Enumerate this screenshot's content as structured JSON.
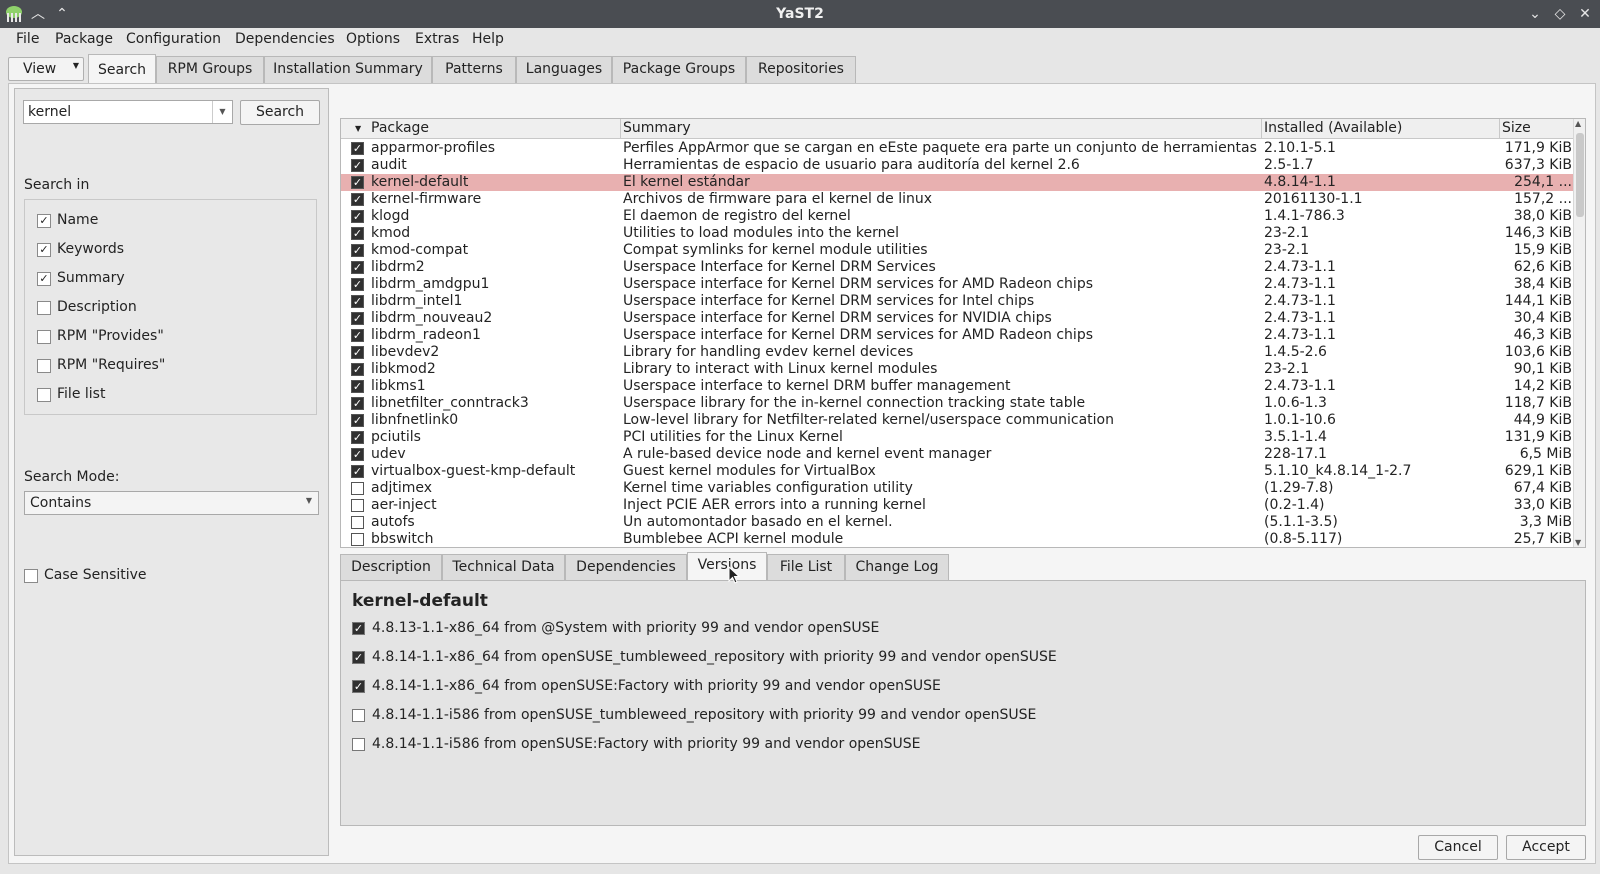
{
  "window": {
    "title": "YaST2"
  },
  "menu": [
    "File",
    "Package",
    "Configuration",
    "Dependencies",
    "Options",
    "Extras",
    "Help"
  ],
  "top_tabs": {
    "view": "View",
    "tabs": [
      "Search",
      "RPM Groups",
      "Installation Summary",
      "Patterns",
      "Languages",
      "Package Groups",
      "Repositories"
    ],
    "active": "Search"
  },
  "search": {
    "query": "kernel",
    "button": "Search",
    "search_in_label": "Search in",
    "options": [
      {
        "label": "Name",
        "checked": true
      },
      {
        "label": "Keywords",
        "checked": true
      },
      {
        "label": "Summary",
        "checked": true
      },
      {
        "label": "Description",
        "checked": false
      },
      {
        "label": "RPM \"Provides\"",
        "checked": false
      },
      {
        "label": "RPM \"Requires\"",
        "checked": false
      },
      {
        "label": "File list",
        "checked": false
      }
    ],
    "mode_label": "Search Mode:",
    "mode_value": "Contains",
    "case_sensitive": "Case Sensitive"
  },
  "table": {
    "headers": [
      "Package",
      "Summary",
      "Installed (Available)",
      "Size"
    ],
    "rows": [
      {
        "installed": true,
        "name": "apparmor-profiles",
        "summary": "Perfiles AppArmor que se cargan en eEste paquete era parte un conjunto de herramientas ...",
        "version": "2.10.1-5.1",
        "size": "171,9 KiB"
      },
      {
        "installed": true,
        "name": "audit",
        "summary": "Herramientas de espacio de usuario para auditoría del kernel 2.6",
        "version": "2.5-1.7",
        "size": "637,3 KiB"
      },
      {
        "installed": true,
        "name": "kernel-default",
        "summary": "El kernel estándar",
        "version": "4.8.14-1.1",
        "size": "254,1 ...",
        "selected": true
      },
      {
        "installed": true,
        "name": "kernel-firmware",
        "summary": "Archivos de firmware para el kernel de linux",
        "version": "20161130-1.1",
        "size": "157,2 ..."
      },
      {
        "installed": true,
        "name": "klogd",
        "summary": "El daemon de registro del kernel",
        "version": "1.4.1-786.3",
        "size": "38,0 KiB"
      },
      {
        "installed": true,
        "name": "kmod",
        "summary": "Utilities to load modules into the kernel",
        "version": "23-2.1",
        "size": "146,3 KiB"
      },
      {
        "installed": true,
        "name": "kmod-compat",
        "summary": "Compat symlinks for kernel module utilities",
        "version": "23-2.1",
        "size": "15,9 KiB"
      },
      {
        "installed": true,
        "name": "libdrm2",
        "summary": "Userspace Interface for Kernel DRM Services",
        "version": "2.4.73-1.1",
        "size": "62,6 KiB"
      },
      {
        "installed": true,
        "name": "libdrm_amdgpu1",
        "summary": "Userspace interface for Kernel DRM services for AMD Radeon chips",
        "version": "2.4.73-1.1",
        "size": "38,4 KiB"
      },
      {
        "installed": true,
        "name": "libdrm_intel1",
        "summary": "Userspace interface for Kernel DRM services for Intel chips",
        "version": "2.4.73-1.1",
        "size": "144,1 KiB"
      },
      {
        "installed": true,
        "name": "libdrm_nouveau2",
        "summary": "Userspace interface for Kernel DRM services for NVIDIA chips",
        "version": "2.4.73-1.1",
        "size": "30,4 KiB"
      },
      {
        "installed": true,
        "name": "libdrm_radeon1",
        "summary": "Userspace interface for Kernel DRM services for AMD Radeon chips",
        "version": "2.4.73-1.1",
        "size": "46,3 KiB"
      },
      {
        "installed": true,
        "name": "libevdev2",
        "summary": "Library for handling evdev kernel devices",
        "version": "1.4.5-2.6",
        "size": "103,6 KiB"
      },
      {
        "installed": true,
        "name": "libkmod2",
        "summary": "Library to interact with Linux kernel modules",
        "version": "23-2.1",
        "size": "90,1 KiB"
      },
      {
        "installed": true,
        "name": "libkms1",
        "summary": "Userspace interface to kernel DRM buffer management",
        "version": "2.4.73-1.1",
        "size": "14,2 KiB"
      },
      {
        "installed": true,
        "name": "libnetfilter_conntrack3",
        "summary": "Userspace library for the in-kernel connection tracking state table",
        "version": "1.0.6-1.3",
        "size": "118,7 KiB"
      },
      {
        "installed": true,
        "name": "libnfnetlink0",
        "summary": "Low-level library for Netfilter-related kernel/userspace communication",
        "version": "1.0.1-10.6",
        "size": "44,9 KiB"
      },
      {
        "installed": true,
        "name": "pciutils",
        "summary": "PCI utilities for the Linux Kernel",
        "version": "3.5.1-1.4",
        "size": "131,9 KiB"
      },
      {
        "installed": true,
        "name": "udev",
        "summary": "A rule-based device node and kernel event manager",
        "version": "228-17.1",
        "size": "6,5 MiB"
      },
      {
        "installed": true,
        "name": "virtualbox-guest-kmp-default",
        "summary": "Guest kernel modules for VirtualBox",
        "version": "5.1.10_k4.8.14_1-2.7",
        "size": "629,1 KiB"
      },
      {
        "installed": false,
        "name": "adjtimex",
        "summary": "Kernel time variables configuration utility",
        "version": "(1.29-7.8)",
        "size": "67,4 KiB"
      },
      {
        "installed": false,
        "name": "aer-inject",
        "summary": "Inject PCIE AER errors into a running kernel",
        "version": "(0.2-1.4)",
        "size": "33,0 KiB"
      },
      {
        "installed": false,
        "name": "autofs",
        "summary": "Un automontador basado en el kernel.",
        "version": "(5.1.1-3.5)",
        "size": "3,3 MiB"
      },
      {
        "installed": false,
        "name": "bbswitch",
        "summary": "Bumblebee ACPI kernel module",
        "version": "(0.8-5.117)",
        "size": "25,7 KiB"
      }
    ]
  },
  "detail_tabs": {
    "tabs": [
      "Description",
      "Technical Data",
      "Dependencies",
      "Versions",
      "File List",
      "Change Log"
    ],
    "active": "Versions"
  },
  "details": {
    "package": "kernel-default",
    "versions": [
      {
        "checked": true,
        "text": "4.8.13-1.1-x86_64 from @System with priority 99 and vendor openSUSE"
      },
      {
        "checked": true,
        "text": "4.8.14-1.1-x86_64 from openSUSE_tumbleweed_repository with priority 99 and vendor openSUSE"
      },
      {
        "checked": true,
        "text": "4.8.14-1.1-x86_64 from openSUSE:Factory with priority 99 and vendor openSUSE"
      },
      {
        "checked": false,
        "text": "4.8.14-1.1-i586 from openSUSE_tumbleweed_repository with priority 99 and vendor openSUSE"
      },
      {
        "checked": false,
        "text": "4.8.14-1.1-i586 from openSUSE:Factory with priority 99 and vendor openSUSE"
      }
    ]
  },
  "buttons": {
    "cancel": "Cancel",
    "accept": "Accept"
  },
  "colors": {
    "titlebar": "#4a4d52",
    "selected_row": "#e8b0b0"
  }
}
